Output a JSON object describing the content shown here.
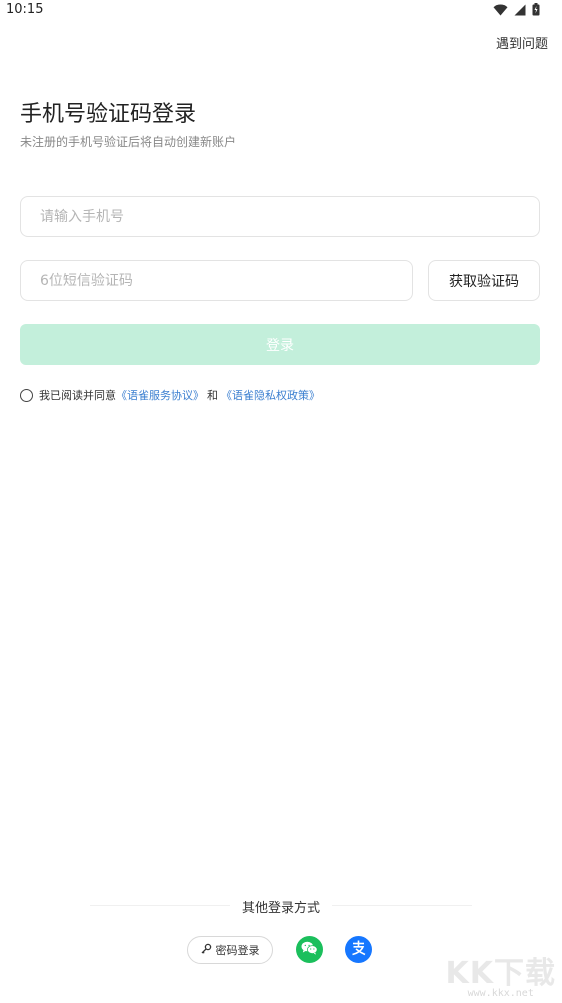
{
  "status_bar": {
    "time": "10:15",
    "icons": [
      "wifi-icon",
      "signal-icon",
      "battery-icon"
    ]
  },
  "header": {
    "help_link": "遇到问题"
  },
  "login": {
    "title": "手机号验证码登录",
    "subtitle": "未注册的手机号验证后将自动创建新账户",
    "phone_placeholder": "请输入手机号",
    "phone_value": "",
    "code_placeholder": "6位短信验证码",
    "code_value": "",
    "get_code_label": "获取验证码",
    "login_label": "登录",
    "login_button_color": "#c3efdb"
  },
  "agreement": {
    "checked": false,
    "prefix": "我已阅读并同意",
    "service_link": "《语雀服务协议》",
    "conjunction": "和",
    "privacy_link": "《语雀隐私权政策》",
    "link_color": "#3b7fd0"
  },
  "other_login": {
    "title": "其他登录方式",
    "password_label": "密码登录",
    "icons": [
      "key-icon",
      "wechat-icon",
      "alipay-icon"
    ],
    "wechat_color": "#1bbf5c",
    "alipay_color": "#1677ff",
    "alipay_glyph": "支"
  },
  "watermark": {
    "logo": "KK下载",
    "url": "www.kkx.net"
  }
}
